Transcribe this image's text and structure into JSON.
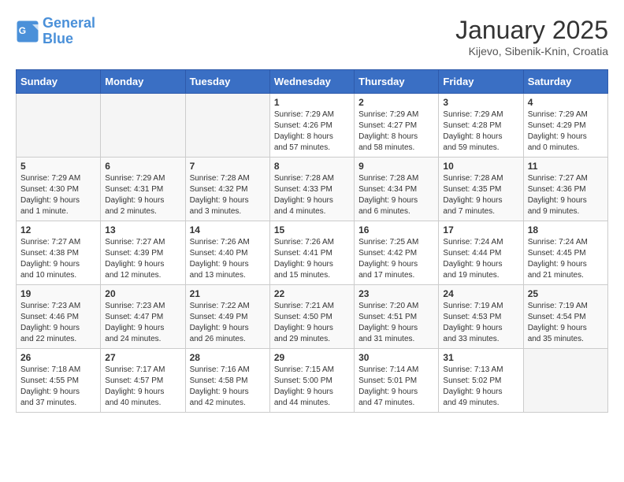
{
  "header": {
    "logo_line1": "General",
    "logo_line2": "Blue",
    "month_title": "January 2025",
    "location": "Kijevo, Sibenik-Knin, Croatia"
  },
  "weekdays": [
    "Sunday",
    "Monday",
    "Tuesday",
    "Wednesday",
    "Thursday",
    "Friday",
    "Saturday"
  ],
  "weeks": [
    [
      {
        "day": "",
        "info": ""
      },
      {
        "day": "",
        "info": ""
      },
      {
        "day": "",
        "info": ""
      },
      {
        "day": "1",
        "info": "Sunrise: 7:29 AM\nSunset: 4:26 PM\nDaylight: 8 hours\nand 57 minutes."
      },
      {
        "day": "2",
        "info": "Sunrise: 7:29 AM\nSunset: 4:27 PM\nDaylight: 8 hours\nand 58 minutes."
      },
      {
        "day": "3",
        "info": "Sunrise: 7:29 AM\nSunset: 4:28 PM\nDaylight: 8 hours\nand 59 minutes."
      },
      {
        "day": "4",
        "info": "Sunrise: 7:29 AM\nSunset: 4:29 PM\nDaylight: 9 hours\nand 0 minutes."
      }
    ],
    [
      {
        "day": "5",
        "info": "Sunrise: 7:29 AM\nSunset: 4:30 PM\nDaylight: 9 hours\nand 1 minute."
      },
      {
        "day": "6",
        "info": "Sunrise: 7:29 AM\nSunset: 4:31 PM\nDaylight: 9 hours\nand 2 minutes."
      },
      {
        "day": "7",
        "info": "Sunrise: 7:28 AM\nSunset: 4:32 PM\nDaylight: 9 hours\nand 3 minutes."
      },
      {
        "day": "8",
        "info": "Sunrise: 7:28 AM\nSunset: 4:33 PM\nDaylight: 9 hours\nand 4 minutes."
      },
      {
        "day": "9",
        "info": "Sunrise: 7:28 AM\nSunset: 4:34 PM\nDaylight: 9 hours\nand 6 minutes."
      },
      {
        "day": "10",
        "info": "Sunrise: 7:28 AM\nSunset: 4:35 PM\nDaylight: 9 hours\nand 7 minutes."
      },
      {
        "day": "11",
        "info": "Sunrise: 7:27 AM\nSunset: 4:36 PM\nDaylight: 9 hours\nand 9 minutes."
      }
    ],
    [
      {
        "day": "12",
        "info": "Sunrise: 7:27 AM\nSunset: 4:38 PM\nDaylight: 9 hours\nand 10 minutes."
      },
      {
        "day": "13",
        "info": "Sunrise: 7:27 AM\nSunset: 4:39 PM\nDaylight: 9 hours\nand 12 minutes."
      },
      {
        "day": "14",
        "info": "Sunrise: 7:26 AM\nSunset: 4:40 PM\nDaylight: 9 hours\nand 13 minutes."
      },
      {
        "day": "15",
        "info": "Sunrise: 7:26 AM\nSunset: 4:41 PM\nDaylight: 9 hours\nand 15 minutes."
      },
      {
        "day": "16",
        "info": "Sunrise: 7:25 AM\nSunset: 4:42 PM\nDaylight: 9 hours\nand 17 minutes."
      },
      {
        "day": "17",
        "info": "Sunrise: 7:24 AM\nSunset: 4:44 PM\nDaylight: 9 hours\nand 19 minutes."
      },
      {
        "day": "18",
        "info": "Sunrise: 7:24 AM\nSunset: 4:45 PM\nDaylight: 9 hours\nand 21 minutes."
      }
    ],
    [
      {
        "day": "19",
        "info": "Sunrise: 7:23 AM\nSunset: 4:46 PM\nDaylight: 9 hours\nand 22 minutes."
      },
      {
        "day": "20",
        "info": "Sunrise: 7:23 AM\nSunset: 4:47 PM\nDaylight: 9 hours\nand 24 minutes."
      },
      {
        "day": "21",
        "info": "Sunrise: 7:22 AM\nSunset: 4:49 PM\nDaylight: 9 hours\nand 26 minutes."
      },
      {
        "day": "22",
        "info": "Sunrise: 7:21 AM\nSunset: 4:50 PM\nDaylight: 9 hours\nand 29 minutes."
      },
      {
        "day": "23",
        "info": "Sunrise: 7:20 AM\nSunset: 4:51 PM\nDaylight: 9 hours\nand 31 minutes."
      },
      {
        "day": "24",
        "info": "Sunrise: 7:19 AM\nSunset: 4:53 PM\nDaylight: 9 hours\nand 33 minutes."
      },
      {
        "day": "25",
        "info": "Sunrise: 7:19 AM\nSunset: 4:54 PM\nDaylight: 9 hours\nand 35 minutes."
      }
    ],
    [
      {
        "day": "26",
        "info": "Sunrise: 7:18 AM\nSunset: 4:55 PM\nDaylight: 9 hours\nand 37 minutes."
      },
      {
        "day": "27",
        "info": "Sunrise: 7:17 AM\nSunset: 4:57 PM\nDaylight: 9 hours\nand 40 minutes."
      },
      {
        "day": "28",
        "info": "Sunrise: 7:16 AM\nSunset: 4:58 PM\nDaylight: 9 hours\nand 42 minutes."
      },
      {
        "day": "29",
        "info": "Sunrise: 7:15 AM\nSunset: 5:00 PM\nDaylight: 9 hours\nand 44 minutes."
      },
      {
        "day": "30",
        "info": "Sunrise: 7:14 AM\nSunset: 5:01 PM\nDaylight: 9 hours\nand 47 minutes."
      },
      {
        "day": "31",
        "info": "Sunrise: 7:13 AM\nSunset: 5:02 PM\nDaylight: 9 hours\nand 49 minutes."
      },
      {
        "day": "",
        "info": ""
      }
    ]
  ]
}
